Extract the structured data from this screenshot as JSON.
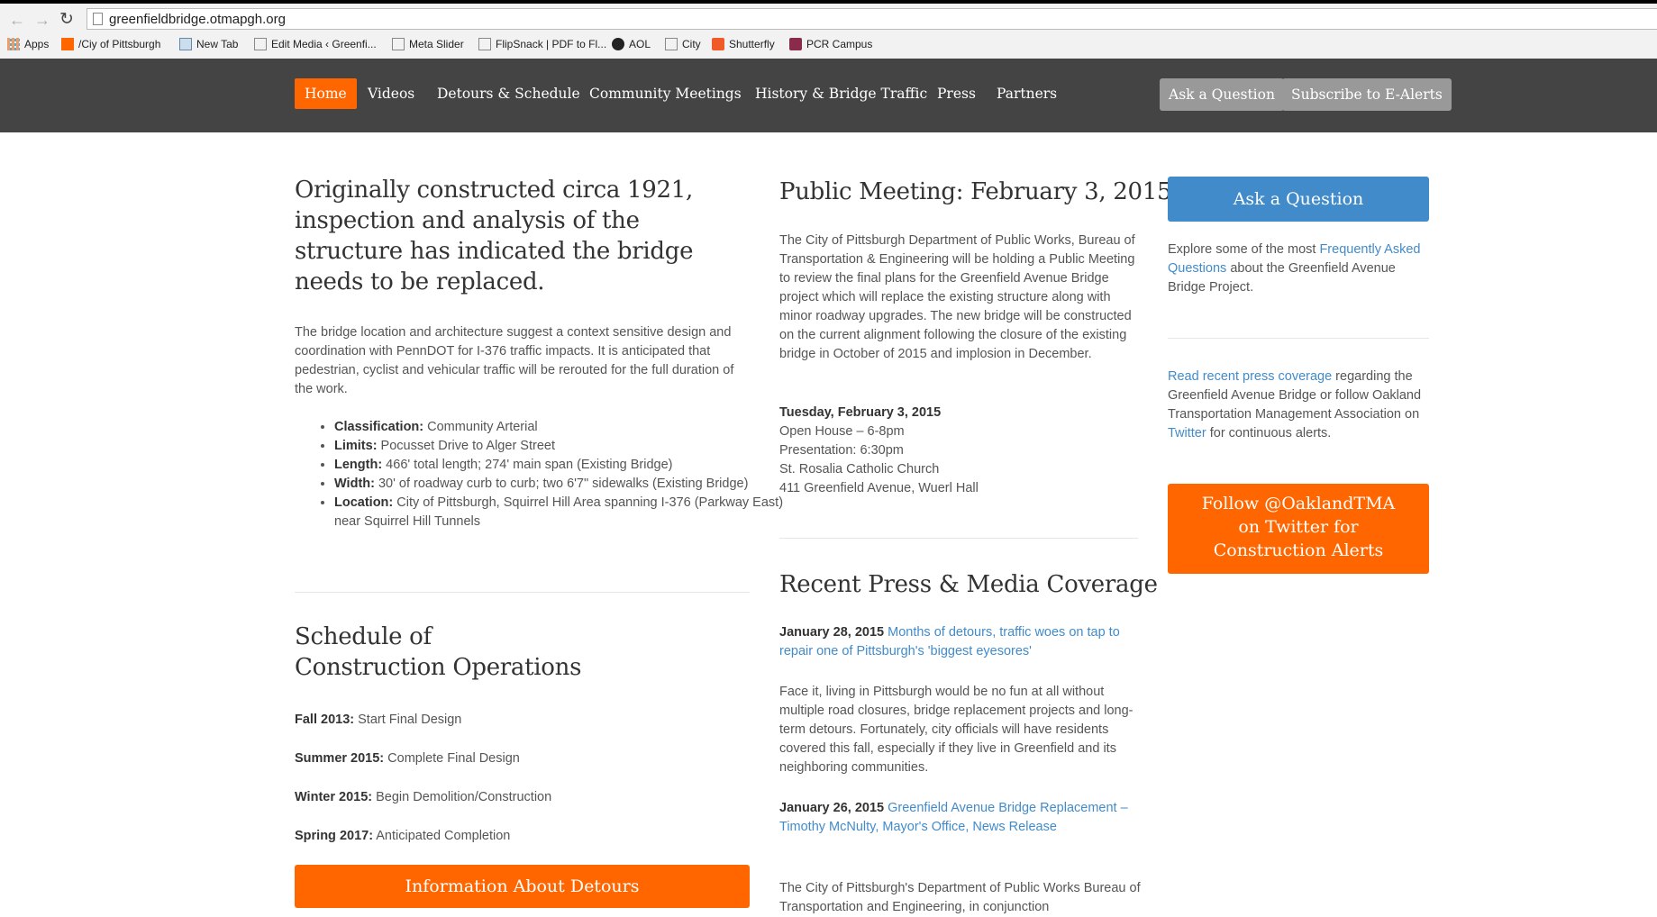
{
  "browser": {
    "url": "greenfieldbridge.otmapgh.org",
    "bookmarks": [
      "Apps",
      "/Ciy of Pittsburgh",
      "New Tab",
      "Edit Media ‹ Greenfi...",
      "Meta Slider",
      "FlipSnack | PDF to Fl...",
      "AOL",
      "City",
      "Shutterfly",
      "PCR Campus"
    ]
  },
  "nav": {
    "items": [
      "Home",
      "Videos",
      "Detours & Schedule",
      "Community Meetings",
      "History & Bridge Traffic",
      "Press",
      "Partners"
    ],
    "ask_label": "Ask a Question",
    "subscribe_label": "Subscribe to E-Alerts"
  },
  "left": {
    "lead": "Originally constructed circa 1921, inspection and analysis of the structure has indicated the bridge needs to be replaced.",
    "intro": "The bridge location and architecture suggest a context sensitive design and coordination with PennDOT for I-376 traffic impacts. It is anticipated that pedestrian, cyclist and vehicular traffic will be rerouted for the full duration of the work.",
    "specs": [
      {
        "label": "Classification:",
        "value": " Community Arterial"
      },
      {
        "label": "Limits:",
        "value": " Pocusset Drive to Alger Street"
      },
      {
        "label": "Length:",
        "value": " 466' total length; 274' main span (Existing Bridge)"
      },
      {
        "label": "Width:",
        "value": " 30' of roadway curb to curb; two 6'7\" sidewalks (Existing Bridge)"
      },
      {
        "label": "Location:",
        "value": " City of Pittsburgh, Squirrel Hill Area spanning I-376 (Parkway East) near Squirrel Hill Tunnels"
      }
    ],
    "schedule_title_1": "Schedule of",
    "schedule_title_2": "Construction Operations",
    "schedule": [
      {
        "label": "Fall 2013:",
        "value": " Start Final Design"
      },
      {
        "label": "Summer 2015:",
        "value": " Complete Final Design"
      },
      {
        "label": "Winter 2015:",
        "value": " Begin Demolition/Construction"
      },
      {
        "label": "Spring 2017:",
        "value": " Anticipated Completion"
      }
    ],
    "detours_button": "Information About Detours"
  },
  "middle": {
    "meeting_title": "Public Meeting: February 3, 2015",
    "meeting_text": "The City of Pittsburgh Department of Public Works, Bureau of Transportation & Engineering will be holding a Public Meeting to review the final plans for the Greenfield Avenue Bridge project which will replace the existing structure along with minor roadway upgrades. The new bridge will be constructed on the current alignment following the closure of the existing bridge in October of 2015 and implosion in December.",
    "meeting_date": "Tuesday, February 3, 2015",
    "meeting_details": [
      "Open House – 6-8pm",
      "Presentation: 6:30pm",
      "St. Rosalia Catholic Church",
      "411 Greenfield Avenue, Wuerl Hall"
    ],
    "press_title": "Recent Press & Media Coverage",
    "press": [
      {
        "date": "January 28, 2015",
        "link": "Months of detours, traffic woes on tap to repair one of Pittsburgh's 'biggest eyesores'",
        "body": "Face it, living in Pittsburgh would be no fun at all without multiple road closures, bridge replacement projects and long-term detours. Fortunately, city officials will have residents covered this fall, especially if they live in Greenfield and its neighboring communities."
      },
      {
        "date": "January 26, 2015",
        "link": "Greenfield Avenue Bridge Replacement – Timothy McNulty, Mayor's Office, News Release",
        "body": "The City of Pittsburgh's Department of Public Works Bureau of Transportation and Engineering, in conjunction"
      }
    ]
  },
  "right": {
    "ask_button": "Ask a Question",
    "faq_pre": "Explore some of the most ",
    "faq_link": "Frequently Asked Questions",
    "faq_post": " about the Greenfield Avenue Bridge Project.",
    "press_link": "Read recent press coverage",
    "press_mid": " regarding the Greenfield Avenue Bridge or follow Oakland Transportation Management Association on ",
    "twitter_link": "Twitter",
    "press_post": " for continuous alerts.",
    "follow_button_1": "Follow @OaklandTMA",
    "follow_button_2": "on Twitter for",
    "follow_button_3": "Construction Alerts"
  },
  "colors": {
    "accent": "#ff6600",
    "link": "#428bca",
    "nav_bg": "#444444"
  }
}
